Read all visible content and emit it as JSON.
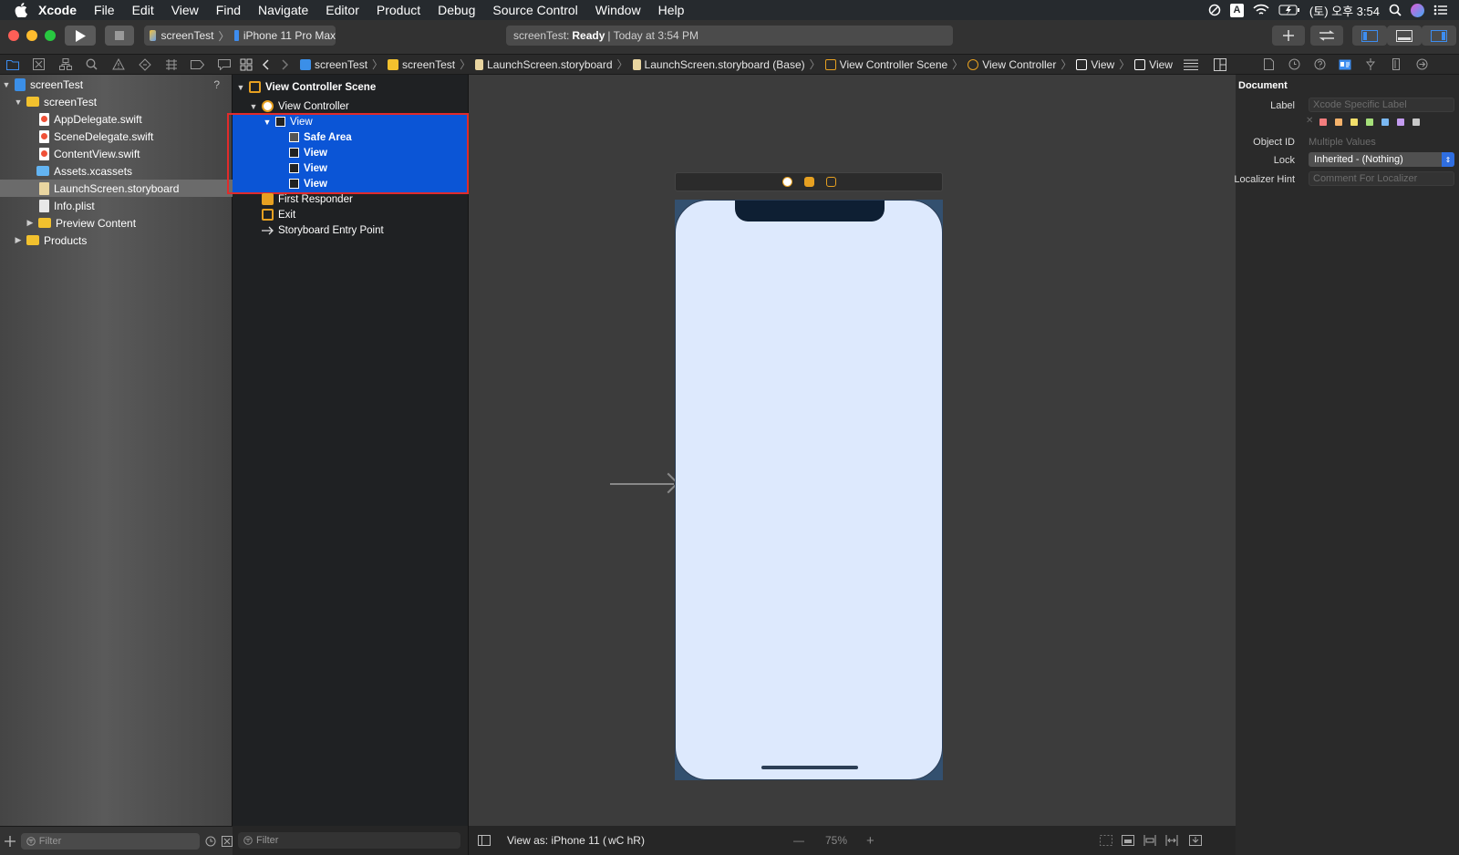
{
  "menubar": {
    "items": [
      "Xcode",
      "File",
      "Edit",
      "View",
      "Find",
      "Navigate",
      "Editor",
      "Product",
      "Debug",
      "Source Control",
      "Window",
      "Help"
    ],
    "clock": "(토) 오후 3:54",
    "input_indicator": "A"
  },
  "toolbar": {
    "scheme_project": "screenTest",
    "scheme_device": "iPhone 11 Pro Max",
    "status_prefix": "screenTest:",
    "status_state": "Ready",
    "status_time": "| Today at 3:54 PM"
  },
  "navigator": {
    "rows": [
      {
        "label": "screenTest",
        "type": "proj",
        "indent": 0,
        "disclosure": "open"
      },
      {
        "label": "screenTest",
        "type": "folder",
        "indent": 1,
        "disclosure": "open"
      },
      {
        "label": "AppDelegate.swift",
        "type": "swift",
        "indent": 2
      },
      {
        "label": "SceneDelegate.swift",
        "type": "swift",
        "indent": 2
      },
      {
        "label": "ContentView.swift",
        "type": "swift",
        "indent": 2
      },
      {
        "label": "Assets.xcassets",
        "type": "xcassets",
        "indent": 2
      },
      {
        "label": "LaunchScreen.storyboard",
        "type": "sb",
        "indent": 2,
        "selected": true
      },
      {
        "label": "Info.plist",
        "type": "plist",
        "indent": 2
      },
      {
        "label": "Preview Content",
        "type": "folder",
        "indent": 2,
        "disclosure": "closed"
      },
      {
        "label": "Products",
        "type": "folder",
        "indent": 1,
        "disclosure": "closed"
      }
    ],
    "help_mark": "?",
    "filter_placeholder": "Filter"
  },
  "jumpbar": {
    "crumbs": [
      "screenTest",
      "screenTest",
      "LaunchScreen.storyboard",
      "LaunchScreen.storyboard (Base)",
      "View Controller Scene",
      "View Controller",
      "View",
      "View"
    ]
  },
  "outline": {
    "scene_title": "View Controller Scene",
    "view_controller": "View Controller",
    "view_root": "View",
    "safe_area": "Safe Area",
    "subviews": [
      "View",
      "View",
      "View"
    ],
    "first_responder": "First Responder",
    "exit": "Exit",
    "entry_point": "Storyboard Entry Point",
    "filter_placeholder": "Filter"
  },
  "canvas": {
    "view_as": "View as: iPhone 11 (",
    "size_class": "wC hR)",
    "zoom": "75%",
    "zoom_out": "—",
    "zoom_in": "+"
  },
  "inspector": {
    "section": "Document",
    "label_label": "Label",
    "label_placeholder": "Xcode Specific Label",
    "object_id_label": "Object ID",
    "object_id_value": "Multiple Values",
    "lock_label": "Lock",
    "lock_value": "Inherited - (Nothing)",
    "localizer_label": "Localizer Hint",
    "localizer_placeholder": "Comment For Localizer",
    "swatch_colors": [
      "#f27d7d",
      "#f5b26b",
      "#f2df6b",
      "#a6e07a",
      "#7ab8f2",
      "#c49cf0",
      "#c8c8c8"
    ]
  },
  "colors": {
    "selection": "#0b55d6",
    "phone_fill": "#dde9fd",
    "highlight_box": "#e12b2b"
  }
}
